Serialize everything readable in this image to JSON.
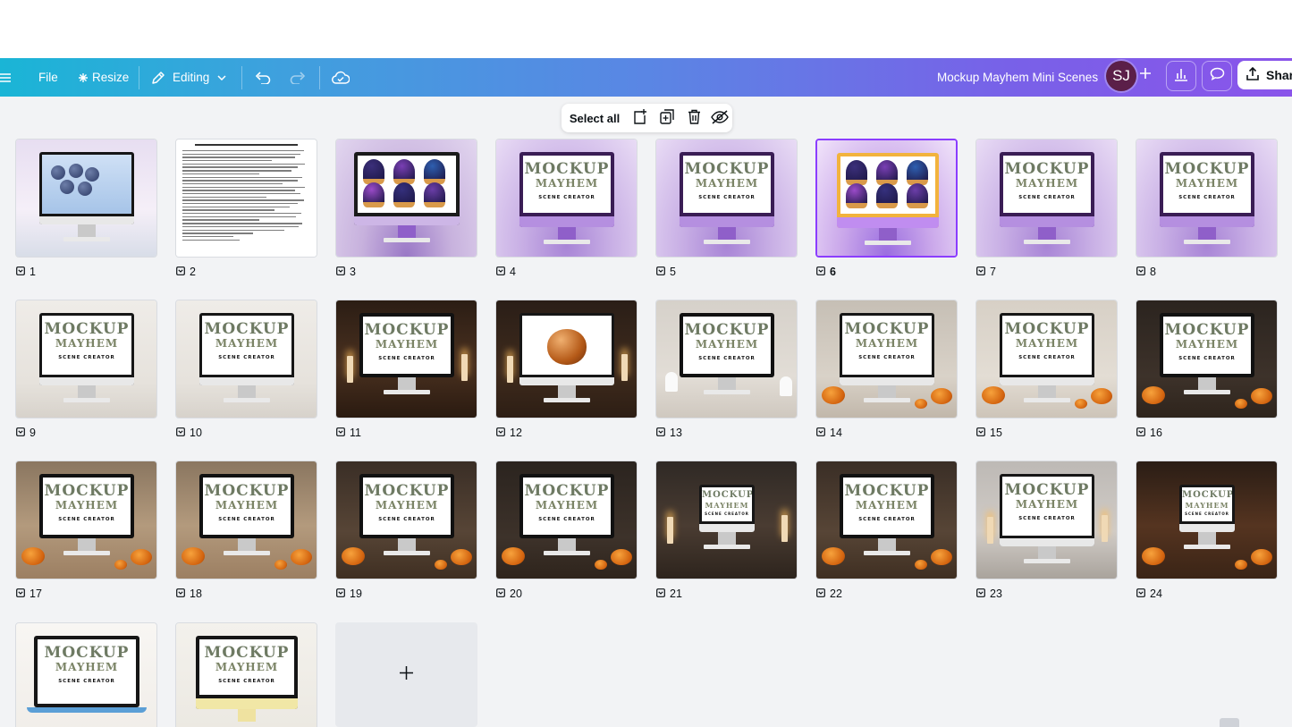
{
  "toolbar": {
    "menu_icon": "hamburger-icon",
    "file_label": "File",
    "resize_label": "Resize",
    "editing_label": "Editing",
    "title": "Mockup Mayhem Mini Scenes",
    "avatar_initials": "SJ",
    "share_label": "Share"
  },
  "selection_bar": {
    "select_all_label": "Select all"
  },
  "mockup_text": {
    "line1": "MOCKUP",
    "line2": "MAYHEM",
    "line3": "SCENE CREATOR"
  },
  "pages": [
    {
      "number": "1",
      "scene": "blueberries"
    },
    {
      "number": "2",
      "scene": "document"
    },
    {
      "number": "3",
      "scene": "cupcakes"
    },
    {
      "number": "4",
      "scene": "purple"
    },
    {
      "number": "5",
      "scene": "purple"
    },
    {
      "number": "6",
      "scene": "cupcakes-selected",
      "selected": true
    },
    {
      "number": "7",
      "scene": "purple"
    },
    {
      "number": "8",
      "scene": "purple"
    },
    {
      "number": "9",
      "scene": "white"
    },
    {
      "number": "10",
      "scene": "white"
    },
    {
      "number": "11",
      "scene": "dark-library"
    },
    {
      "number": "12",
      "scene": "caramel-apple"
    },
    {
      "number": "13",
      "scene": "ghosts"
    },
    {
      "number": "14",
      "scene": "ghosts-pumpkins"
    },
    {
      "number": "15",
      "scene": "pumpkins-tree"
    },
    {
      "number": "16",
      "scene": "dark-pumpkins"
    },
    {
      "number": "17",
      "scene": "autumn"
    },
    {
      "number": "18",
      "scene": "autumn"
    },
    {
      "number": "19",
      "scene": "jack-o-lantern"
    },
    {
      "number": "20",
      "scene": "dark-pumpkins"
    },
    {
      "number": "21",
      "scene": "gothic-desk"
    },
    {
      "number": "22",
      "scene": "jack-o-lantern"
    },
    {
      "number": "23",
      "scene": "cobweb-candles"
    },
    {
      "number": "24",
      "scene": "haunted-desk"
    },
    {
      "number": "",
      "scene": "laptop"
    },
    {
      "number": "",
      "scene": "yellow-monitor"
    }
  ],
  "add_page": {
    "icon": "plus-icon"
  },
  "colors": {
    "accent": "#8b3dff",
    "toolbar_gradient_start": "#1ab5d6",
    "toolbar_gradient_end": "#8a54ea"
  }
}
